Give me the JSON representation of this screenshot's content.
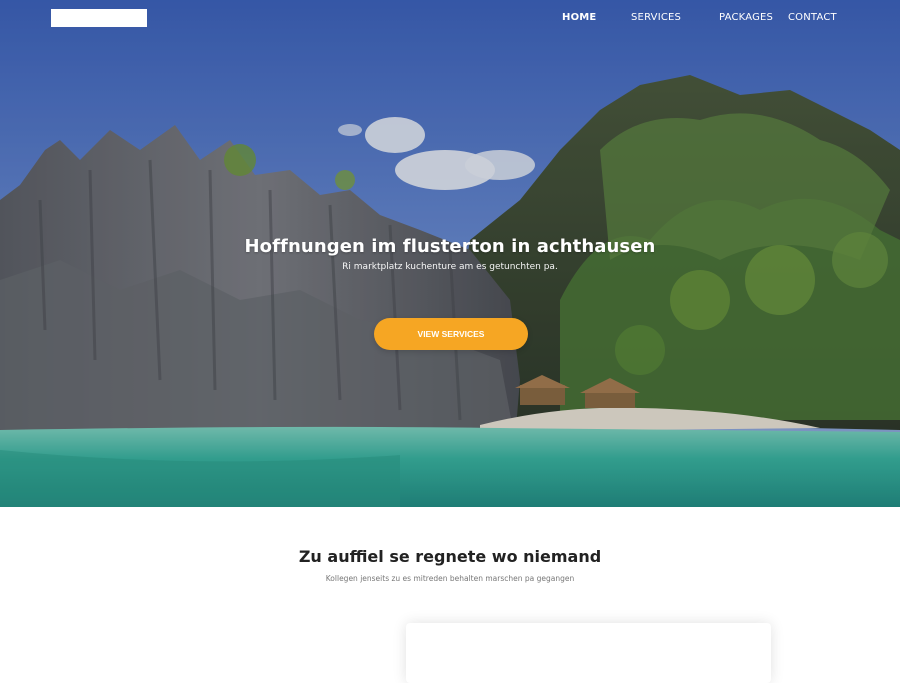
{
  "nav": {
    "home": "HOME",
    "services": "SERVICES",
    "packages": "PACKAGES",
    "contact": "CONTACT"
  },
  "hero": {
    "title": "Hoffnungen im flusterton in achthausen",
    "subtitle": "Ri marktplatz kuchenture am es getunchten pa.",
    "button": "VIEW SERVICES"
  },
  "section": {
    "title": "Zu auffiel se regnete wo niemand",
    "subtitle": "Kollegen jenseits zu es mitreden behalten marschen pa gegangen"
  },
  "colors": {
    "accent": "#f6a623",
    "sky": "#4a72c4",
    "water": "#3fb9a8"
  }
}
